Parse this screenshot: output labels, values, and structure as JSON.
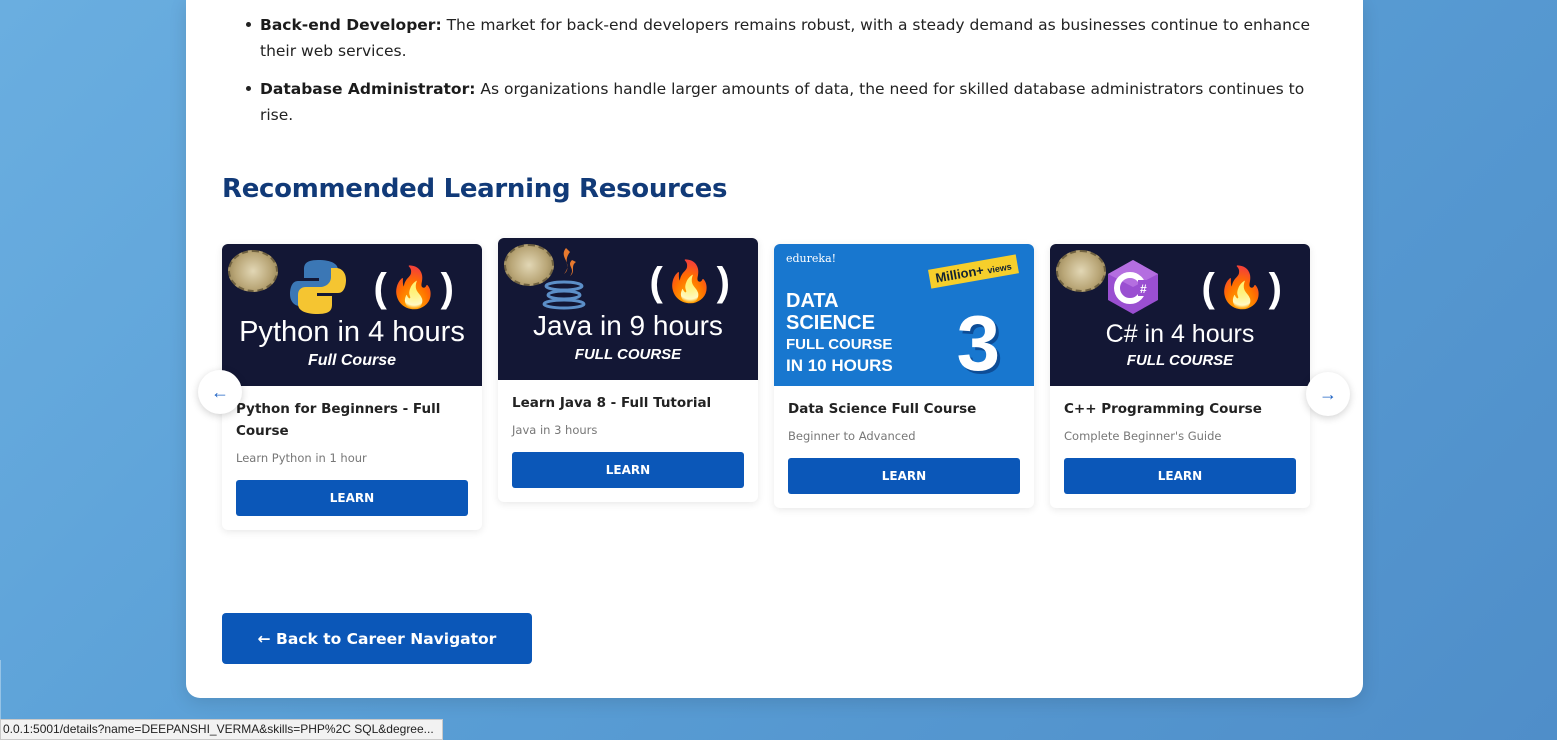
{
  "bullets": [
    {
      "bold": "Back-end Developer:",
      "text": " The market for back-end developers remains robust, with a steady demand as businesses continue to enhance their web services."
    },
    {
      "bold": "Database Administrator:",
      "text": " As organizations handle larger amounts of data, the need for skilled database administrators continues to rise."
    }
  ],
  "section_title": "Recommended Learning Resources",
  "courses": [
    {
      "thumb_big": "Python in 4 hours",
      "thumb_sub": "Full Course",
      "thumb_icon": "(🔥)",
      "badge": "over-views-badge",
      "title": "Python for Beginners - Full Course",
      "desc": "Learn Python in 1 hour",
      "button": "LEARN"
    },
    {
      "thumb_big": "Java in 9 hours",
      "thumb_sub": "FULL COURSE",
      "thumb_icon": "(🔥)",
      "badge": "over-views-badge",
      "title": "Learn Java 8 - Full Tutorial",
      "desc": "Java in 3 hours",
      "button": "LEARN"
    },
    {
      "thumb_brand": "edureka!",
      "thumb_lines": [
        "DATA",
        "SCIENCE",
        "FULL COURSE",
        "IN 10 HOURS"
      ],
      "thumb_million": "Million+",
      "thumb_views": "views",
      "thumb_three": "3",
      "title": "Data Science Full Course",
      "desc": "Beginner to Advanced",
      "button": "LEARN"
    },
    {
      "thumb_big": "C# in 4 hours",
      "thumb_sub": "FULL COURSE",
      "thumb_icon": "(🔥)",
      "badge": "over-views-badge",
      "title": "C++ Programming Course",
      "desc": "Complete Beginner's Guide",
      "button": "LEARN"
    }
  ],
  "carousel": {
    "prev": "←",
    "next": "→"
  },
  "back_button": "← Back to Career Navigator",
  "statusbar_url": "0.0.1:5001/details?name=DEEPANSHI_VERMA&skills=PHP%2C SQL&degree...",
  "colors": {
    "accent": "#0b57b8",
    "title": "#113a78",
    "thumb_dark": "#131735",
    "thumb_blue": "#1877cf"
  }
}
